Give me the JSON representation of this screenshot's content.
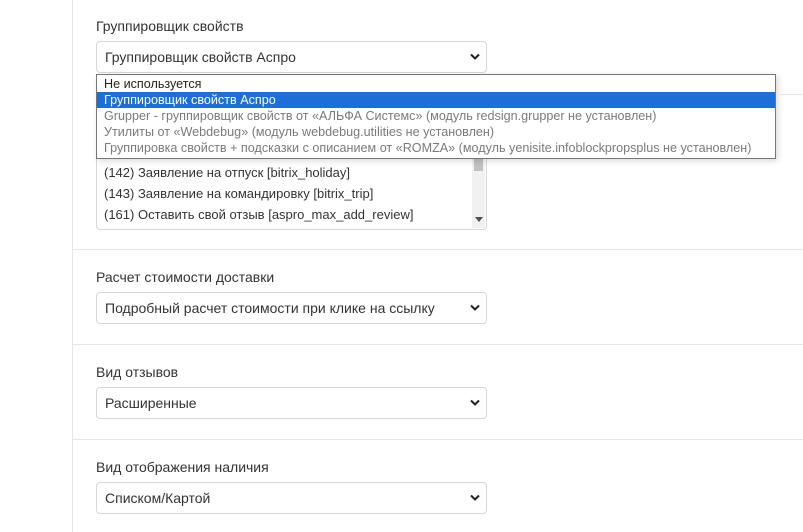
{
  "grouper": {
    "label": "Группировщик свойств",
    "selected": "Группировщик свойств Аспро",
    "options": [
      {
        "text": "Не используется",
        "state": "normal"
      },
      {
        "text": "Группировщик свойств Аспро",
        "state": "selected"
      },
      {
        "text": "Grupper - группировщик свойств от «АЛЬФА Системс» (модуль redsign.grupper не установлен)",
        "state": "disabled"
      },
      {
        "text": "Утилиты от «Webdebug» (модуль webdebug.utilities не установлен)",
        "state": "disabled"
      },
      {
        "text": "Группировка свойств + подсказки с описанием от «ROMZA» (модуль yenisite.infoblockpropsplus не установлен)",
        "state": "disabled"
      }
    ]
  },
  "forms_list": {
    "items": [
      "(142) Заявление на отпуск [bitrix_holiday]",
      "(143) Заявление на командировку [bitrix_trip]",
      "(161) Оставить свой отзыв [aspro_max_add_review]"
    ]
  },
  "delivery": {
    "label": "Расчет стоимости доставки",
    "selected": "Подробный расчет стоимости при клике на ссылку"
  },
  "reviews": {
    "label": "Вид отзывов",
    "selected": "Расширенные"
  },
  "availability": {
    "label": "Вид отображения наличия",
    "selected": "Списком/Картой"
  },
  "colors": {
    "selected_option_bg": "#1e6ed8",
    "border": "#d7d7d7",
    "divider": "#e6e6e6"
  },
  "icons": {
    "select_arrow": "chevron-down-icon",
    "scroll_up": "scroll-up-arrow-icon",
    "scroll_down": "scroll-down-arrow-icon"
  }
}
